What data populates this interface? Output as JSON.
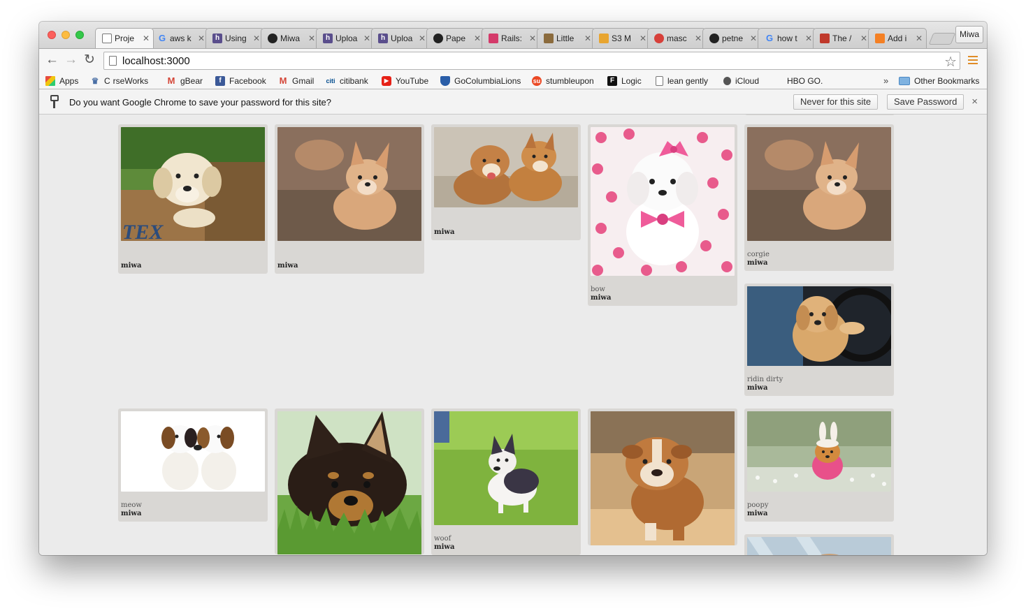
{
  "tabs": [
    {
      "title": "Proje",
      "favicon": "doc-icon",
      "color": "#ffffff",
      "active": true
    },
    {
      "title": "aws k",
      "favicon": "google-icon",
      "color": "#4285f4"
    },
    {
      "title": "Using",
      "favicon": "heroku-icon",
      "color": "#5a4e8c"
    },
    {
      "title": "Miwa",
      "favicon": "github-icon",
      "color": "#222222"
    },
    {
      "title": "Uploa",
      "favicon": "heroku-icon",
      "color": "#5a4e8c"
    },
    {
      "title": "Uploa",
      "favicon": "heroku-icon",
      "color": "#5a4e8c"
    },
    {
      "title": "Pape",
      "favicon": "github-icon",
      "color": "#222222"
    },
    {
      "title": "Rails:",
      "favicon": "railscast-icon",
      "color": "#d43a6a"
    },
    {
      "title": "Little",
      "favicon": "little-icon",
      "color": "#8b6b3d"
    },
    {
      "title": "S3 M",
      "favicon": "s3-icon",
      "color": "#e8a530"
    },
    {
      "title": "masc",
      "favicon": "shield-icon",
      "color": "#d7403a"
    },
    {
      "title": "petne",
      "favicon": "github-icon",
      "color": "#222222"
    },
    {
      "title": "how t",
      "favicon": "google-icon",
      "color": "#4285f4"
    },
    {
      "title": "The /",
      "favicon": "book-icon",
      "color": "#c0392b"
    },
    {
      "title": "Add i",
      "favicon": "stack-icon",
      "color": "#f48024"
    }
  ],
  "profile": "Miwa",
  "url": "localhost:3000",
  "bookmarks": [
    {
      "label": "Apps",
      "icon": "apps-grid-icon",
      "color": "#e74c3c"
    },
    {
      "label": "C",
      "icon": "crown-icon",
      "color": "#4a6fa5"
    },
    {
      "label": "rseWorks",
      "icon": "",
      "color": ""
    },
    {
      "label": "gBear",
      "icon": "gmail-icon",
      "color": "#d44638"
    },
    {
      "label": "Facebook",
      "icon": "facebook-icon",
      "color": "#3b5998"
    },
    {
      "label": "Gmail",
      "icon": "gmail-icon",
      "color": "#d44638"
    },
    {
      "label": "citibank",
      "icon": "citi-icon",
      "color": "#004b8d"
    },
    {
      "label": "YouTube",
      "icon": "youtube-icon",
      "color": "#e62117"
    },
    {
      "label": "GoColumbiaLions",
      "icon": "crest-icon",
      "color": "#2a5ea8"
    },
    {
      "label": "stumbleupon",
      "icon": "stumbleupon-icon",
      "color": "#eb4924"
    },
    {
      "label": "Logic",
      "icon": "logic-icon",
      "color": "#111111"
    },
    {
      "label": "lean gently",
      "icon": "doc-icon",
      "color": "#ffffff"
    },
    {
      "label": "iCloud",
      "icon": "apple-icon",
      "color": "#555555"
    },
    {
      "label": "HBO GO.",
      "icon": "",
      "color": ""
    }
  ],
  "bookmarks_more": "»",
  "other_bookmarks": "Other Bookmarks",
  "infobar": {
    "message": "Do you want Google Chrome to save your password for this site?",
    "never_button": "Never for this site",
    "save_button": "Save Password",
    "close": "×"
  },
  "cards": [
    {
      "desc": "",
      "user": "miwa",
      "image": "puppy-in-crate"
    },
    {
      "desc": "",
      "user": "miwa",
      "image": "corgi-puppy"
    },
    {
      "desc": "",
      "user": "miwa",
      "image": "two-corgi-puppies"
    },
    {
      "desc": "bow",
      "user": "miwa",
      "image": "white-puppy-pink-bow"
    },
    {
      "desc": "corgie",
      "user": "miwa",
      "image": "corgi-puppy"
    },
    {
      "desc": "ridin dirty",
      "user": "miwa",
      "image": "puppy-driving"
    },
    {
      "desc": "meow",
      "user": "miwa",
      "image": "beagle-puppies"
    },
    {
      "desc": "",
      "user": "",
      "image": "shepherd-puppy-grass"
    },
    {
      "desc": "woof",
      "user": "miwa",
      "image": "corgi-running"
    },
    {
      "desc": "",
      "user": "",
      "image": "bulldog-puppy"
    },
    {
      "desc": "poopy",
      "user": "miwa",
      "image": "pomeranian-bunny"
    },
    {
      "desc": "",
      "user": "",
      "image": "partial-puppy"
    }
  ]
}
